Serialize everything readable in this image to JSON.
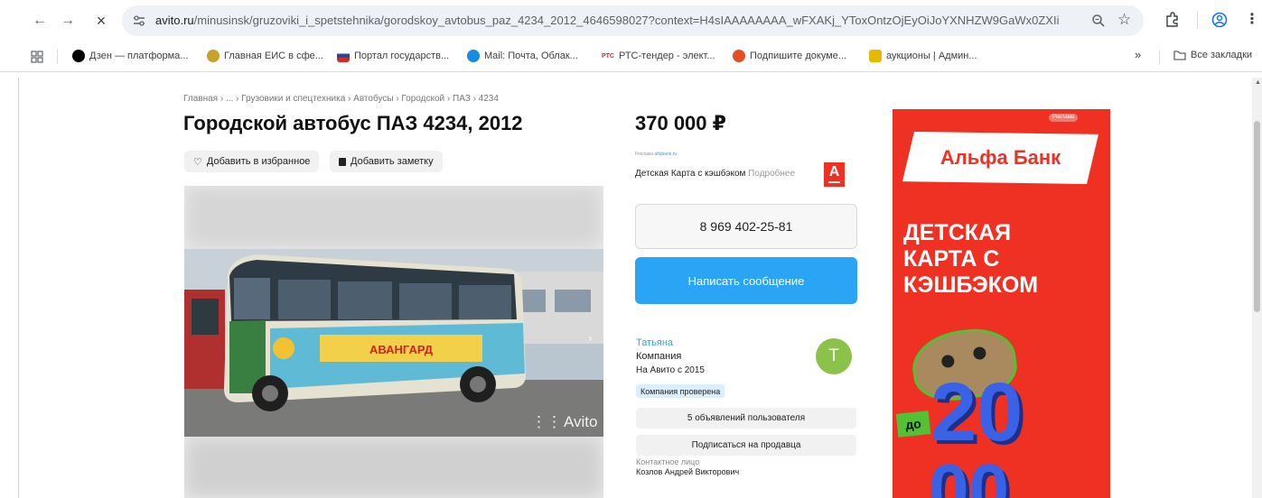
{
  "browser": {
    "url_domain": "avito.ru",
    "url_rest": "/minusinsk/gruzoviki_i_spetstehnika/gorodskoy_avtobus_paz_4234_2012_4646598027?context=H4sIAAAAAAAA_wFXAKj_YToxOntzOjEyOiJoYXNHZW9GaWx0ZXIiO2I...",
    "bookmarks": [
      {
        "label": "Дзен — платформа...",
        "color": "#000000"
      },
      {
        "label": "Главная ЕИС в сфе...",
        "color": "#c8a02a"
      },
      {
        "label": "Портал государств...",
        "color": "#1e4ca0"
      },
      {
        "label": "Mail: Почта, Облак...",
        "color": "#168de2"
      },
      {
        "label": "РТС-тендер - элект...",
        "color": "#d6262b"
      },
      {
        "label": "Подпишите докуме...",
        "color": "#e44d26"
      },
      {
        "label": "аукционы | Админ...",
        "color": "#e7b800"
      }
    ],
    "more_label": "»",
    "all_bookmarks": "Все закладки"
  },
  "listing": {
    "breadcrumbs": "Главная › ... › Грузовики и спецтехника › Автобусы › Городской › ПАЗ › 4234",
    "title": "Городской автобус ПАЗ 4234, 2012",
    "favorite_label": "Добавить в избранное",
    "note_label": "Добавить заметку",
    "photo_brand": "Avito",
    "bus_ad_text": "АВАНГАРД"
  },
  "side": {
    "price": "370 000 ₽",
    "ad_label": "Реклама",
    "ad_domain": "alfabank.ru",
    "ad_text": "Детская Карта с кэшбэком",
    "ad_more": "Подробнее",
    "phone": "8 969 402-25-81",
    "message_button": "Написать сообщение",
    "seller_name": "Татьяна",
    "seller_type": "Компания",
    "seller_since": "На Авито с 2015",
    "verified": "Компания проверена",
    "avatar_letter": "Т",
    "ads_button": "5 объявлений пользователя",
    "subscribe_button": "Подписаться на продавца",
    "contact_label": "Контактное лицо",
    "contact_name": "Козлов Андрей Викторович"
  },
  "banner": {
    "tag": "Реклама",
    "bank": "Альфа Банк",
    "line1": "ДЕТСКАЯ",
    "line2": "КАРТА С",
    "line3": "КЭШБЭКОМ",
    "prefix": "до",
    "number": "20",
    "brand_color": "#ef3124"
  }
}
